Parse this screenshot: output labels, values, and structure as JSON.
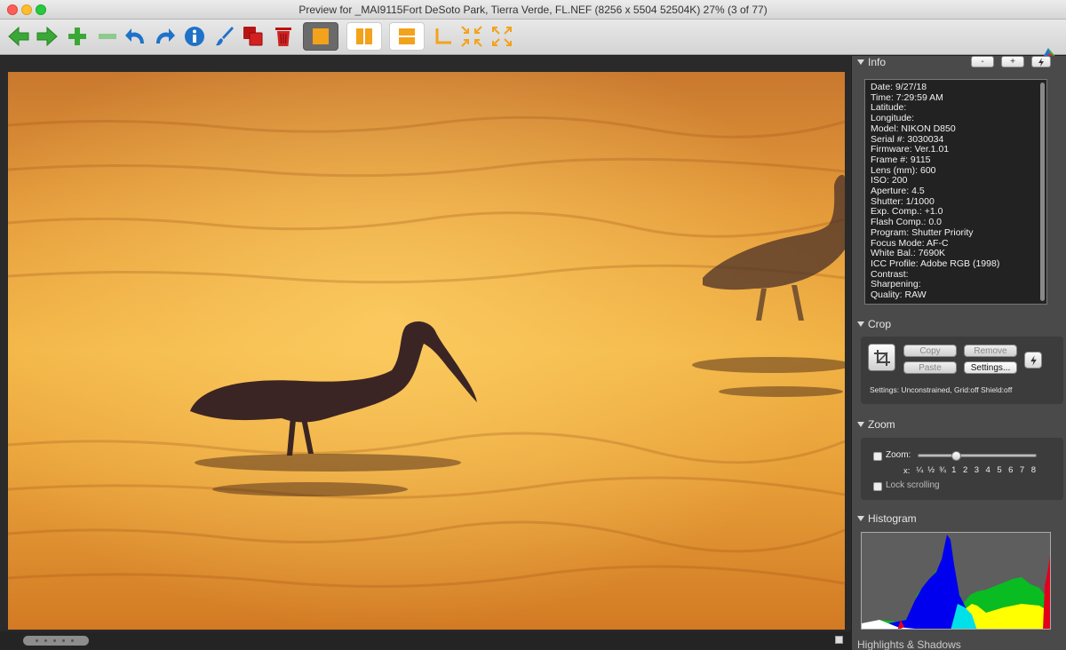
{
  "window": {
    "title": "Preview for _MAI9115Fort DeSoto Park, Tierra Verde, FL.NEF (8256 x 5504 52504K) 27% (3 of 77)"
  },
  "toolbar": {
    "icons": [
      "arrow-left-icon",
      "arrow-right-icon",
      "plus-icon",
      "minus-icon",
      "undo-icon",
      "redo-icon",
      "info-icon",
      "brush-icon",
      "layers-icon",
      "trash-icon",
      "single-view-icon",
      "split-vertical-icon",
      "split-horizontal-icon",
      "crop-corner-icon",
      "shrink-icon",
      "expand-icon"
    ],
    "accent_green": "#3aa836",
    "accent_blue": "#1f72c8",
    "accent_orange": "#f3a21c"
  },
  "info": {
    "heading": "Info",
    "minus_label": "-",
    "plus_label": "+",
    "lines": [
      "Date: 9/27/18",
      "Time: 7:29:59 AM",
      "Latitude:",
      "Longitude:",
      "Model: NIKON D850",
      "Serial #: 3030034",
      "Firmware: Ver.1.01",
      "Frame #: 9115",
      "Lens (mm): 600",
      "ISO: 200",
      "Aperture: 4.5",
      "Shutter: 1/1000",
      "Exp. Comp.: +1.0",
      "Flash Comp.: 0.0",
      "Program: Shutter Priority",
      "Focus Mode: AF-C",
      "White Bal.: 7690K",
      "ICC Profile: Adobe RGB (1998)",
      "Contrast:",
      "Sharpening:",
      "Quality: RAW"
    ]
  },
  "crop": {
    "heading": "Crop",
    "copy_label": "Copy",
    "remove_label": "Remove",
    "paste_label": "Paste",
    "settings_label": "Settings...",
    "settings_text": "Settings:  Unconstrained, Grid:off Shield:off"
  },
  "zoom": {
    "heading": "Zoom",
    "zoom_label": "Zoom:",
    "x_label": "x:",
    "ticks": [
      "¼",
      "½",
      "¾",
      "1",
      "2",
      "3",
      "4",
      "5",
      "6",
      "7",
      "8"
    ],
    "slider_fraction": 0.32,
    "lock_label": "Lock scrolling"
  },
  "histogram": {
    "heading": "Histogram"
  },
  "bottom": {
    "partial_label": "Highlights & Shadows"
  }
}
